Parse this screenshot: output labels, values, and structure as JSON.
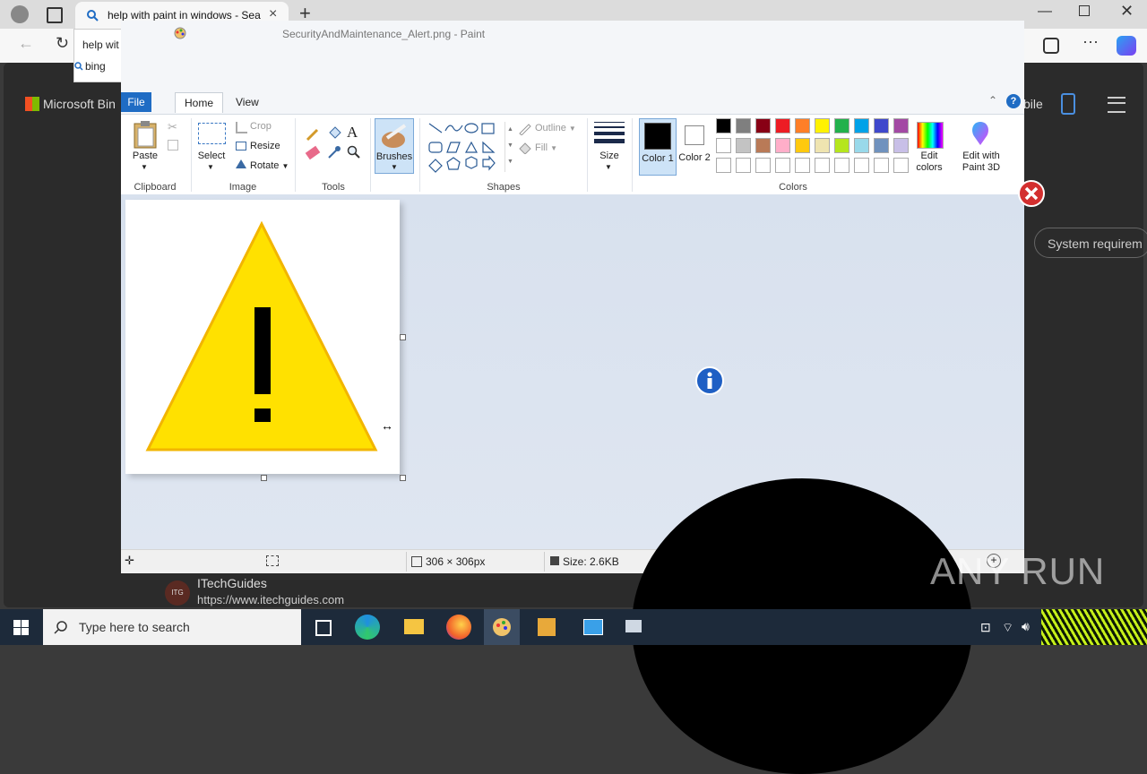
{
  "browser": {
    "tab_title": "help with paint in windows - Sea",
    "omnibox_text": "help wit",
    "omnibox_suggestion": "bing",
    "page": {
      "logo_text": "Microsoft Bin",
      "right_text": "bile",
      "pill_button": "System requirem",
      "result_favicon_text": "ITG",
      "result_site": "ITechGuides",
      "result_url": "https://www.itechguides.com"
    }
  },
  "paint": {
    "title": "SecurityAndMaintenance_Alert.png - Paint",
    "tabs": [
      "File",
      "Home",
      "View"
    ],
    "clipboard": {
      "paste": "Paste",
      "group": "Clipboard"
    },
    "image": {
      "select": "Select",
      "crop": "Crop",
      "resize": "Resize",
      "rotate": "Rotate",
      "group": "Image"
    },
    "tools": {
      "group": "Tools"
    },
    "brushes": {
      "label": "Brushes"
    },
    "shapes": {
      "outline": "Outline",
      "fill": "Fill",
      "group": "Shapes"
    },
    "size": {
      "label": "Size"
    },
    "colors": {
      "color1": "Color 1",
      "color2": "Color 2",
      "edit_colors": "Edit colors",
      "edit_paint3d": "Edit with Paint 3D",
      "group": "Colors",
      "color1_value": "#000000",
      "color2_value": "#ffffff",
      "palette_row1": [
        "#000000",
        "#7f7f7f",
        "#880015",
        "#ed1c24",
        "#ff7f27",
        "#fff200",
        "#22b14c",
        "#00a2e8",
        "#3f48cc",
        "#a349a4"
      ],
      "palette_row2": [
        "#ffffff",
        "#c3c3c3",
        "#b97a57",
        "#ffaec9",
        "#ffc90e",
        "#efe4b0",
        "#b5e61d",
        "#99d9ea",
        "#7092be",
        "#c8bfe7"
      ],
      "palette_row3": [
        "#ffffff",
        "#ffffff",
        "#ffffff",
        "#ffffff",
        "#ffffff",
        "#ffffff",
        "#ffffff",
        "#ffffff",
        "#ffffff",
        "#ffffff"
      ]
    },
    "status": {
      "dimensions": "306 × 306px",
      "file_size": "Size: 2.6KB"
    }
  },
  "watermark": "ANY RUN",
  "taskbar": {
    "search_placeholder": "Type here to search"
  }
}
